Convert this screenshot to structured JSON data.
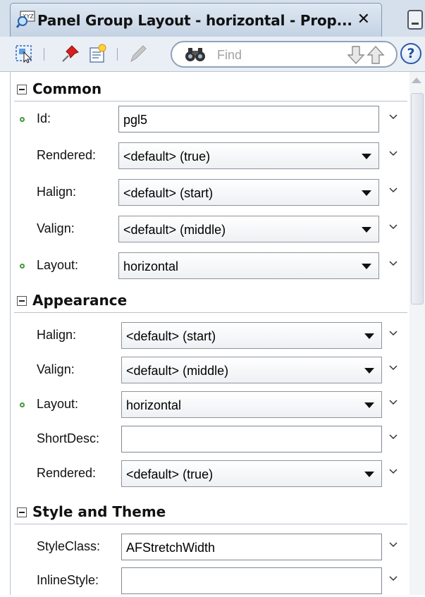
{
  "window": {
    "title": "Panel Group Layout - horizontal - Prop...",
    "close_glyph": "✕"
  },
  "toolbar": {
    "icons": [
      "select-component-icon",
      "pin-icon",
      "edit-properties-icon",
      "pencil-icon",
      "binoculars-icon"
    ],
    "find_placeholder": "Find",
    "help_label": "?"
  },
  "sections": {
    "common": {
      "title": "Common",
      "fields": [
        {
          "label": "Id:",
          "value": "pgl5",
          "kind": "text",
          "set": true
        },
        {
          "label": "Rendered:",
          "value": "<default> (true)",
          "kind": "combo",
          "set": false
        },
        {
          "label": "Halign:",
          "value": "<default> (start)",
          "kind": "combo",
          "set": false
        },
        {
          "label": "Valign:",
          "value": "<default> (middle)",
          "kind": "combo",
          "set": false
        },
        {
          "label": "Layout:",
          "value": "horizontal",
          "kind": "combo",
          "set": true
        }
      ]
    },
    "appearance": {
      "title": "Appearance",
      "fields": [
        {
          "label": "Halign:",
          "value": "<default> (start)",
          "kind": "combo",
          "set": false
        },
        {
          "label": "Valign:",
          "value": "<default> (middle)",
          "kind": "combo",
          "set": false
        },
        {
          "label": "Layout:",
          "value": "horizontal",
          "kind": "combo",
          "set": true
        },
        {
          "label": "ShortDesc:",
          "value": "",
          "kind": "text",
          "set": false
        },
        {
          "label": "Rendered:",
          "value": "<default> (true)",
          "kind": "combo",
          "set": false
        }
      ]
    },
    "style": {
      "title": "Style and Theme",
      "fields": [
        {
          "label": "StyleClass:",
          "value": "AFStretchWidth",
          "kind": "text",
          "set": false
        },
        {
          "label": "InlineStyle:",
          "value": "",
          "kind": "text",
          "set": false
        }
      ]
    }
  },
  "colors": {
    "set_indicator": "#3c9a3c",
    "titlebar": "#d5e0ec",
    "toolbar": "#eaeff5"
  }
}
